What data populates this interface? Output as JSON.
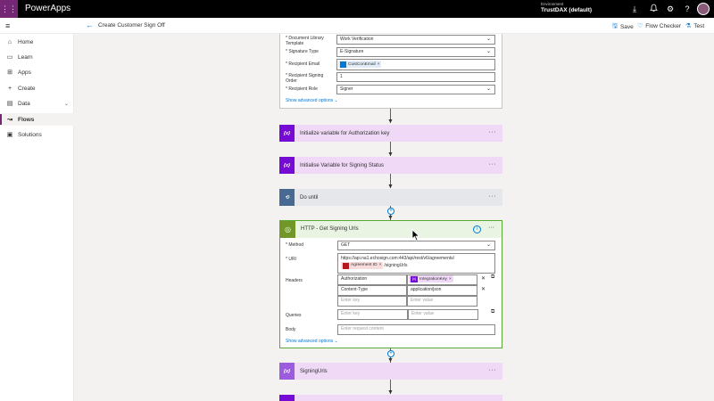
{
  "topbar": {
    "app_name": "PowerApps",
    "environment_label": "Environment",
    "environment_value": "TrustDAX (default)"
  },
  "commandbar": {
    "flow_title": "Create Customer Sign Off",
    "save": "Save",
    "flow_checker": "Flow Checker",
    "test": "Test"
  },
  "sidebar": {
    "items": [
      {
        "label": "Home"
      },
      {
        "label": "Learn"
      },
      {
        "label": "Apps"
      },
      {
        "label": "Create"
      },
      {
        "label": "Data"
      },
      {
        "label": "Flows"
      },
      {
        "label": "Solutions"
      }
    ]
  },
  "signature_card": {
    "fields": [
      {
        "label": "* Document Library Template",
        "value": "Work Verification"
      },
      {
        "label": "* Signature Type",
        "value": "E-Signature"
      },
      {
        "label": "* Recipient Email",
        "token": "CustConEmail"
      },
      {
        "label": "* Recipient Signing Order",
        "value": "1"
      },
      {
        "label": "* Recipient Role",
        "value": "Signer"
      }
    ],
    "advanced": "Show advanced options"
  },
  "actions": {
    "init_auth": "Initialize variable for Authorization key",
    "init_signing": "Initialise Variable for Signing Status",
    "do_until": "Do until",
    "signing_urls": "SigningUrls"
  },
  "http": {
    "title": "HTTP - Get Signing Urls",
    "method_label": "* Method",
    "method_value": "GET",
    "uri_label": "* URI",
    "uri_value": "https://api.na1.echosign.com:443/api/rest/v6/agreements/",
    "uri_token": "Agreement ID",
    "uri_suffix": "/signingUrls",
    "headers_label": "Headers",
    "headers": [
      {
        "key": "Authorization",
        "token": "IntegrationKey"
      },
      {
        "key": "Content-Type",
        "value": "application/json"
      }
    ],
    "key_placeholder": "Enter key",
    "value_placeholder": "Enter value",
    "queries_label": "Queries",
    "body_label": "Body",
    "body_placeholder": "Enter request content",
    "advanced": "Show advanced options"
  },
  "icons": {
    "variable": "{x}",
    "colors": {
      "brand": "#742774",
      "variable": "#770bd6",
      "http": "#709727",
      "do_until": "#486991",
      "accent": "#0078d4"
    }
  }
}
